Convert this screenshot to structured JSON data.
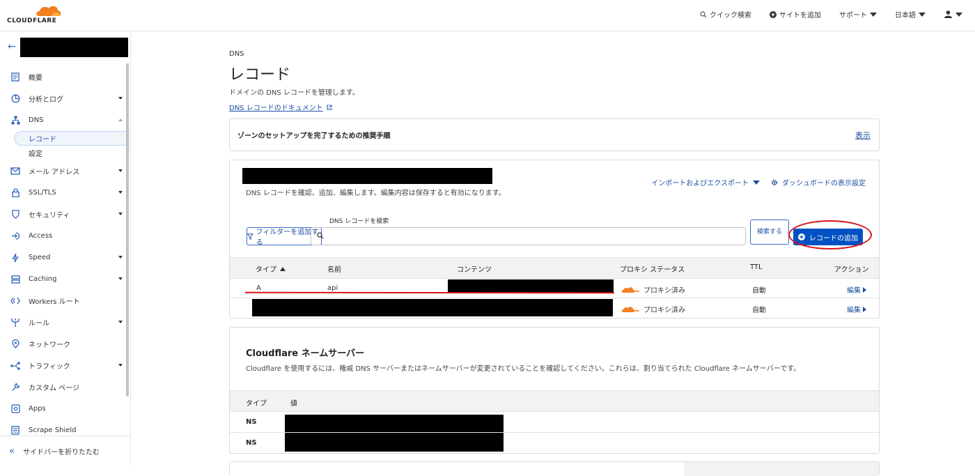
{
  "brand": {
    "logo_text": "CLOUDFLARE",
    "accent": "#f38020",
    "link": "#1a4ea1",
    "primary_button": "#0051c3",
    "annotation": "#d8141a"
  },
  "topnav": {
    "search": "クイック検索",
    "add_site": "サイトを追加",
    "support": "サポート",
    "language": "日本語"
  },
  "sidebar": {
    "items": [
      {
        "label": "概要",
        "icon": "document-icon"
      },
      {
        "label": "分析とログ",
        "icon": "chart-icon"
      },
      {
        "label": "DNS",
        "icon": "network-icon"
      },
      {
        "label": "メール アドレス",
        "icon": "mail-icon"
      },
      {
        "label": "SSL/TLS",
        "icon": "lock-icon"
      },
      {
        "label": "セキュリティ",
        "icon": "shield-icon"
      },
      {
        "label": "Access",
        "icon": "login-icon"
      },
      {
        "label": "Speed",
        "icon": "bolt-icon"
      },
      {
        "label": "Caching",
        "icon": "server-icon"
      },
      {
        "label": "Workers ルート",
        "icon": "workers-icon"
      },
      {
        "label": "ルール",
        "icon": "fork-icon"
      },
      {
        "label": "ネットワーク",
        "icon": "location-icon"
      },
      {
        "label": "トラフィック",
        "icon": "traffic-icon"
      },
      {
        "label": "カスタム ページ",
        "icon": "wrench-icon"
      },
      {
        "label": "Apps",
        "icon": "apps-icon"
      },
      {
        "label": "Scrape Shield",
        "icon": "scrape-icon"
      }
    ],
    "dns_sub": [
      "レコード",
      "設定"
    ],
    "collapse": "サイドバーを折りたたむ"
  },
  "page": {
    "crumb": "DNS",
    "title": "レコード",
    "desc": "ドメインの DNS レコードを管理します。",
    "doc_link": "DNS レコードのドキュメント"
  },
  "setup": {
    "title": "ゾーンのセットアップを完了するための推奨手順",
    "show": "表示"
  },
  "records": {
    "desc": "DNS レコードを確認、追加、編集します。編集内容は保存すると有効になります。",
    "import_export": "インポートおよびエクスポート",
    "dashboard_settings": "ダッシュボードの表示設定",
    "filter": "フィルターを追加する",
    "search_label": "DNS レコードを検索",
    "search_button": "検索する",
    "add_button": "レコードの追加",
    "columns": [
      "タイプ",
      "名前",
      "コンテンツ",
      "プロキシ ステータス",
      "TTL",
      "アクション"
    ],
    "rows": [
      {
        "type": "A",
        "name": "api",
        "proxy": "プロキシ済み",
        "ttl": "自動",
        "action": "編集"
      },
      {
        "type": "",
        "name": "",
        "proxy": "プロキシ済み",
        "ttl": "自動",
        "action": "編集"
      }
    ]
  },
  "nameservers": {
    "title": "Cloudflare ネームサーバー",
    "desc": "Cloudflare を使用するには、権威 DNS サーバーまたはネームサーバーが変更されていることを確認してください。これらは、割り当てられた Cloudflare ネームサーバーです。",
    "columns": [
      "タイプ",
      "値"
    ],
    "rows": [
      {
        "type": "NS"
      },
      {
        "type": "NS"
      }
    ]
  }
}
